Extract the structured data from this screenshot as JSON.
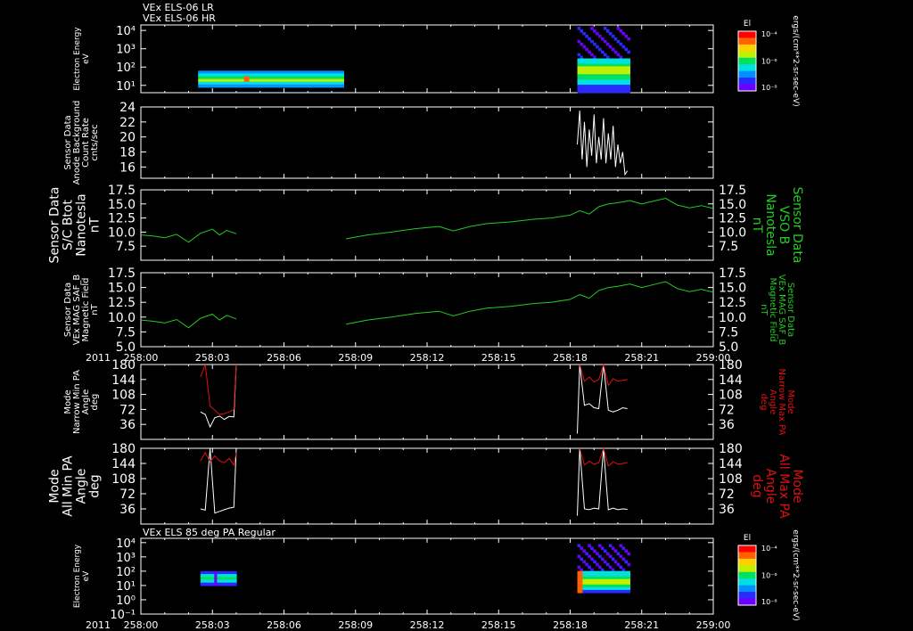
{
  "headers": {
    "top_line1": "VEx ELS-06 LR",
    "top_line2": "VEx ELS-06 HR",
    "panel7": "VEx ELS 85 deg PA Regular"
  },
  "time_axis": {
    "year": "2011",
    "ticks": [
      "258:00",
      "258:03",
      "258:06",
      "258:09",
      "258:12",
      "258:15",
      "258:18",
      "258:21",
      "259:00"
    ],
    "tick_minutes": [
      0,
      3,
      6,
      9,
      12,
      15,
      18,
      21,
      24
    ]
  },
  "colorbars": [
    {
      "title": "El",
      "ticks": [
        "10⁻⁴",
        "10⁻⁶",
        "10⁻⁸"
      ],
      "unit": "ergs/(cm**2-sr-sec-eV)"
    },
    {
      "title": "El",
      "ticks": [
        "10⁻⁴",
        "10⁻⁶",
        "10⁻⁸"
      ],
      "unit": "ergs/(cm**2-sr-sec-eV)"
    }
  ],
  "colors": {
    "white": "#ffffff",
    "green": "#22cc22",
    "red": "#dd1111",
    "background": "#000000"
  },
  "panels": [
    {
      "id": "electron-energy-lr-hr",
      "left_label": [
        "Electron Energy",
        "eV"
      ],
      "right_label": [],
      "y_ticks": [
        "10⁴",
        "10³",
        "10²",
        "10¹"
      ],
      "y_tick_values": [
        4,
        3,
        2,
        1
      ],
      "ylim_log10": [
        0.6,
        4.3
      ]
    },
    {
      "id": "anode-background",
      "left_label": [
        "Sensor Data",
        "Anode Background",
        "Count Rate",
        "cnts/sec"
      ],
      "right_label": [],
      "y_ticks": [
        "24",
        "22",
        "20",
        "18",
        "16"
      ],
      "y_tick_values": [
        24,
        22,
        20,
        18,
        16
      ],
      "ylim": [
        14.5,
        24
      ]
    },
    {
      "id": "sc-btot",
      "left_label": [
        "Sensor Data",
        "S/C Btot",
        "Nanotesla",
        "nT"
      ],
      "right_label": [
        "Sensor Data",
        "VSO B",
        "Nanotesla",
        "nT"
      ],
      "y_ticks": [
        "17.5",
        "15.0",
        "12.5",
        "10.0",
        "7.5"
      ],
      "y_tick_values": [
        17.5,
        15.0,
        12.5,
        10.0,
        7.5
      ],
      "ylim": [
        5.0,
        17.5
      ]
    },
    {
      "id": "mag-saf-b",
      "left_label": [
        "Sensor Data",
        "VEx MAG SAF_B",
        "Magnetic Field",
        "nT"
      ],
      "right_label": [
        "Sensor Data",
        "VEx MAG SAF_B",
        "Magnetic Field",
        "nT"
      ],
      "y_ticks": [
        "17.5",
        "15.0",
        "12.5",
        "10.0",
        "7.5",
        "5.0"
      ],
      "y_tick_values": [
        17.5,
        15.0,
        12.5,
        10.0,
        7.5,
        5.0
      ],
      "ylim": [
        5.0,
        17.5
      ]
    },
    {
      "id": "narrow-pa",
      "left_label": [
        "Mode",
        "Narrow Min PA",
        "Angle",
        "deg"
      ],
      "right_label": [
        "Mode",
        "Narrow Max PA",
        "Angle",
        "deg"
      ],
      "y_ticks": [
        "180",
        "144",
        "108",
        "72",
        "36"
      ],
      "y_tick_values": [
        180,
        144,
        108,
        72,
        36
      ],
      "ylim": [
        0,
        180
      ]
    },
    {
      "id": "all-pa",
      "left_label": [
        "Mode",
        "All Min PA",
        "Angle",
        "deg"
      ],
      "right_label": [
        "Mode",
        "All Max PA",
        "Angle",
        "deg"
      ],
      "y_ticks": [
        "180",
        "144",
        "108",
        "72",
        "36"
      ],
      "y_tick_values": [
        180,
        144,
        108,
        72,
        36
      ],
      "ylim": [
        0,
        180
      ]
    },
    {
      "id": "electron-energy-85pa",
      "left_label": [
        "Electron Energy",
        "eV"
      ],
      "right_label": [],
      "y_ticks": [
        "10⁴",
        "10³",
        "10²",
        "10¹",
        "10⁰",
        "10⁻¹"
      ],
      "y_tick_values": [
        4,
        3,
        2,
        1,
        0,
        -1
      ],
      "ylim_log10": [
        -1,
        4.3
      ]
    }
  ],
  "chart_data": [
    {
      "type": "heatmap",
      "title": "VEx ELS-06 LR / VEx ELS-06 HR",
      "ylabel": "Electron Energy eV",
      "x_unit": "minutes after 258:00",
      "blocks": [
        {
          "x_range": [
            2.4,
            8.5
          ],
          "log10E_range": [
            0.9,
            1.8
          ],
          "level": "high"
        },
        {
          "x_range": [
            18.3,
            20.5
          ],
          "log10E_range": [
            0.6,
            4.2
          ],
          "level": "high"
        }
      ]
    },
    {
      "type": "line",
      "title": "",
      "ylabel": "Anode Background Count Rate cnts/sec",
      "series": [
        {
          "x": [
            18.3,
            18.4,
            18.5,
            18.6,
            18.7,
            18.8,
            18.9,
            19.0,
            19.1,
            19.2,
            19.3,
            19.4,
            19.5,
            19.6,
            19.7,
            19.8,
            19.9,
            20.0,
            20.1,
            20.2,
            20.3,
            20.4
          ],
          "y": [
            19,
            23.5,
            17,
            22,
            16,
            21,
            17.5,
            23,
            16.5,
            20,
            17,
            22.5,
            16.5,
            20.5,
            17,
            21.5,
            16,
            19,
            16.5,
            18,
            15,
            15.5
          ]
        }
      ]
    },
    {
      "type": "line",
      "title": "",
      "ylabel": "S/C Btot nT",
      "series": [
        {
          "x": [
            0,
            0.5,
            1,
            1.5,
            2,
            2.5,
            3,
            3.3,
            3.6,
            4.0,
            8.6,
            9.5,
            10.5,
            11.5,
            12.5,
            13.1,
            13.8,
            14.5,
            15.5,
            16.5,
            17.2,
            18.0,
            18.4,
            18.8,
            19.2,
            19.6,
            20.0,
            20.5,
            21.0,
            21.5,
            22.0,
            22.5,
            23.0,
            23.5,
            24.0
          ],
          "y": [
            9.5,
            9.3,
            9.0,
            9.6,
            8.2,
            9.8,
            10.5,
            9.5,
            10.3,
            9.7,
            8.8,
            9.5,
            10.0,
            10.6,
            11.0,
            10.2,
            11.0,
            11.5,
            11.8,
            12.3,
            12.5,
            13.0,
            13.8,
            13.2,
            14.5,
            15.0,
            15.2,
            15.6,
            15.0,
            15.5,
            16.0,
            14.8,
            14.3,
            14.7,
            14.2
          ]
        }
      ]
    },
    {
      "type": "line",
      "title": "",
      "ylabel": "VEx MAG SAF_B Magnetic Field nT",
      "series": [
        {
          "x": [
            0,
            0.5,
            1,
            1.5,
            2,
            2.5,
            3,
            3.3,
            3.6,
            4.0,
            8.6,
            9.5,
            10.5,
            11.5,
            12.5,
            13.1,
            13.8,
            14.5,
            15.5,
            16.5,
            17.2,
            18.0,
            18.4,
            18.8,
            19.2,
            19.6,
            20.0,
            20.5,
            21.0,
            21.5,
            22.0,
            22.5,
            23.0,
            23.5,
            24.0
          ],
          "y": [
            9.5,
            9.3,
            9.0,
            9.6,
            8.2,
            9.8,
            10.5,
            9.5,
            10.3,
            9.7,
            8.8,
            9.5,
            10.0,
            10.6,
            11.0,
            10.2,
            11.0,
            11.5,
            11.8,
            12.3,
            12.5,
            13.0,
            13.8,
            13.2,
            14.5,
            15.0,
            15.2,
            15.6,
            15.0,
            15.5,
            16.0,
            14.8,
            14.3,
            14.7,
            14.2
          ]
        }
      ]
    },
    {
      "type": "line",
      "title": "",
      "ylabel": "Narrow Min PA / Narrow Max PA Angle deg",
      "series": [
        {
          "name": "Narrow Min PA",
          "color": "#ffffff",
          "x": [
            2.5,
            2.7,
            2.9,
            3.1,
            3.3,
            3.5,
            3.7,
            3.9,
            4.0,
            18.3,
            18.4,
            18.6,
            18.8,
            19.0,
            19.2,
            19.4,
            19.6,
            19.8,
            20.0,
            20.2,
            20.4
          ],
          "y": [
            66,
            60,
            30,
            52,
            56,
            48,
            55,
            54,
            180,
            14,
            180,
            82,
            86,
            76,
            74,
            180,
            70,
            66,
            70,
            76,
            74
          ]
        },
        {
          "name": "Narrow Max PA",
          "color": "#dd1111",
          "x": [
            2.5,
            2.7,
            2.9,
            3.1,
            3.3,
            3.5,
            3.7,
            3.9,
            4.0,
            18.4,
            18.6,
            18.8,
            19.0,
            19.2,
            19.4,
            19.6,
            19.8,
            20.0,
            20.2,
            20.4
          ],
          "y": [
            150,
            180,
            80,
            70,
            60,
            62,
            66,
            72,
            180,
            180,
            140,
            150,
            138,
            144,
            180,
            130,
            146,
            140,
            142,
            144
          ]
        }
      ]
    },
    {
      "type": "line",
      "title": "",
      "ylabel": "All Min PA / All Max PA Angle deg",
      "series": [
        {
          "name": "All Min PA",
          "color": "#ffffff",
          "x": [
            2.5,
            2.7,
            2.9,
            3.1,
            3.3,
            3.5,
            3.7,
            3.9,
            4.0,
            18.3,
            18.4,
            18.6,
            18.8,
            19.0,
            19.2,
            19.4,
            19.6,
            19.8,
            20.0,
            20.2,
            20.4
          ],
          "y": [
            36,
            33,
            180,
            26,
            30,
            34,
            38,
            40,
            180,
            20,
            180,
            36,
            34,
            38,
            36,
            180,
            34,
            38,
            34,
            36,
            35
          ]
        },
        {
          "name": "All Max PA",
          "color": "#dd1111",
          "x": [
            2.5,
            2.7,
            2.9,
            3.1,
            3.3,
            3.5,
            3.7,
            3.9,
            4.0,
            18.4,
            18.6,
            18.8,
            19.0,
            19.2,
            19.4,
            19.6,
            19.8,
            20.0,
            20.2,
            20.4
          ],
          "y": [
            150,
            170,
            148,
            162,
            150,
            146,
            156,
            140,
            170,
            180,
            140,
            150,
            142,
            146,
            180,
            138,
            148,
            142,
            144,
            146
          ]
        }
      ]
    },
    {
      "type": "heatmap",
      "title": "VEx ELS 85 deg PA Regular",
      "ylabel": "Electron Energy eV",
      "x_unit": "minutes after 258:00",
      "blocks": [
        {
          "x_range": [
            2.5,
            4.0
          ],
          "log10E_range": [
            1.0,
            2.0
          ],
          "level": "high"
        },
        {
          "x_range": [
            18.3,
            20.5
          ],
          "log10E_range": [
            0.5,
            3.9
          ],
          "level": "high"
        }
      ]
    }
  ]
}
